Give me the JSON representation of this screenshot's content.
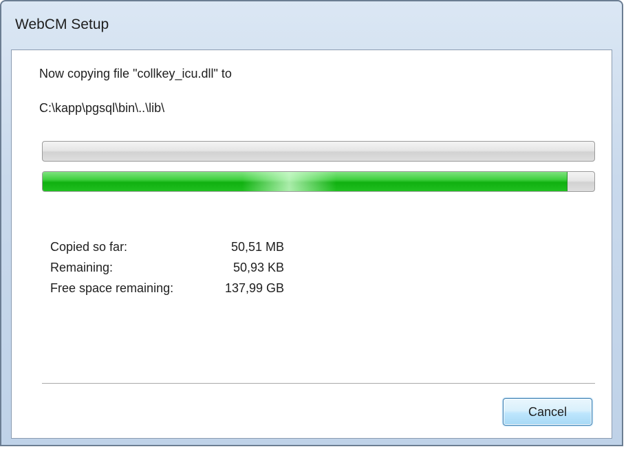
{
  "window": {
    "title": "WebCM Setup"
  },
  "message": {
    "line1": "Now copying file \"collkey_icu.dll\" to",
    "line2": "C:\\kapp\\pgsql\\bin\\..\\lib\\"
  },
  "progress": {
    "file_progress": 0,
    "overall_progress": 0.95,
    "fill_color": "#1fbf1f"
  },
  "stats": [
    {
      "label": "Copied so far:",
      "value": "50,51 MB"
    },
    {
      "label": "Remaining:",
      "value": "50,93 KB"
    },
    {
      "label": "Free space remaining:",
      "value": "137,99 GB"
    }
  ],
  "buttons": {
    "cancel_label": "Cancel"
  }
}
